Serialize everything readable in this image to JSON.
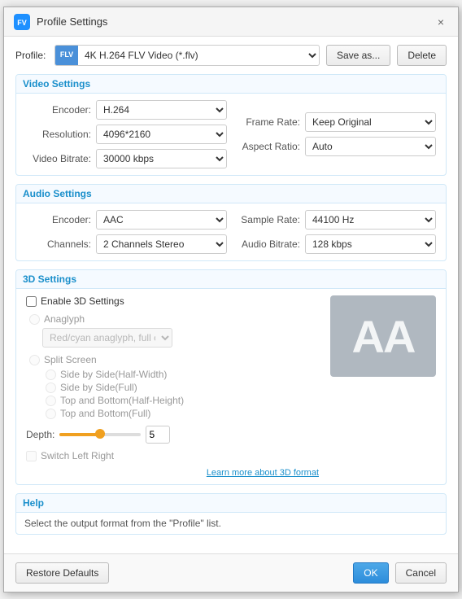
{
  "titleBar": {
    "title": "Profile Settings",
    "closeLabel": "×",
    "appIconText": "FV"
  },
  "profile": {
    "label": "Profile:",
    "selectedOption": "4K H.264 FLV Video (*.flv)",
    "iconText": "FLV",
    "saveAsLabel": "Save as...",
    "deleteLabel": "Delete"
  },
  "videoSettings": {
    "sectionTitle": "Video Settings",
    "encoderLabel": "Encoder:",
    "encoderValue": "H.264",
    "resolutionLabel": "Resolution:",
    "resolutionValue": "4096*2160",
    "videoBitrateLabel": "Video Bitrate:",
    "videoBitrateValue": "30000 kbps",
    "frameRateLabel": "Frame Rate:",
    "frameRateValue": "Keep Original",
    "aspectRatioLabel": "Aspect Ratio:",
    "aspectRatioValue": "Auto"
  },
  "audioSettings": {
    "sectionTitle": "Audio Settings",
    "encoderLabel": "Encoder:",
    "encoderValue": "AAC",
    "channelsLabel": "Channels:",
    "channelsValue": "2 Channels Stereo",
    "sampleRateLabel": "Sample Rate:",
    "sampleRateValue": "44100 Hz",
    "audioBitrateLabel": "Audio Bitrate:",
    "audioBitrateValue": "128 kbps"
  },
  "threeDSettings": {
    "sectionTitle": "3D Settings",
    "enableLabel": "Enable 3D Settings",
    "anaglyphLabel": "Anaglyph",
    "anaglyphOption": "Red/cyan anaglyph, full color",
    "splitScreenLabel": "Split Screen",
    "sideHalfLabel": "Side by Side(Half-Width)",
    "sideFullLabel": "Side by Side(Full)",
    "topHalfLabel": "Top and Bottom(Half-Height)",
    "topFullLabel": "Top and Bottom(Full)",
    "depthLabel": "Depth:",
    "depthValue": "5",
    "switchLabel": "Switch Left Right",
    "learnMoreLabel": "Learn more about 3D format",
    "previewText": "AA"
  },
  "help": {
    "sectionTitle": "Help",
    "helpText": "Select the output format from the \"Profile\" list."
  },
  "footer": {
    "restoreLabel": "Restore Defaults",
    "okLabel": "OK",
    "cancelLabel": "Cancel"
  }
}
